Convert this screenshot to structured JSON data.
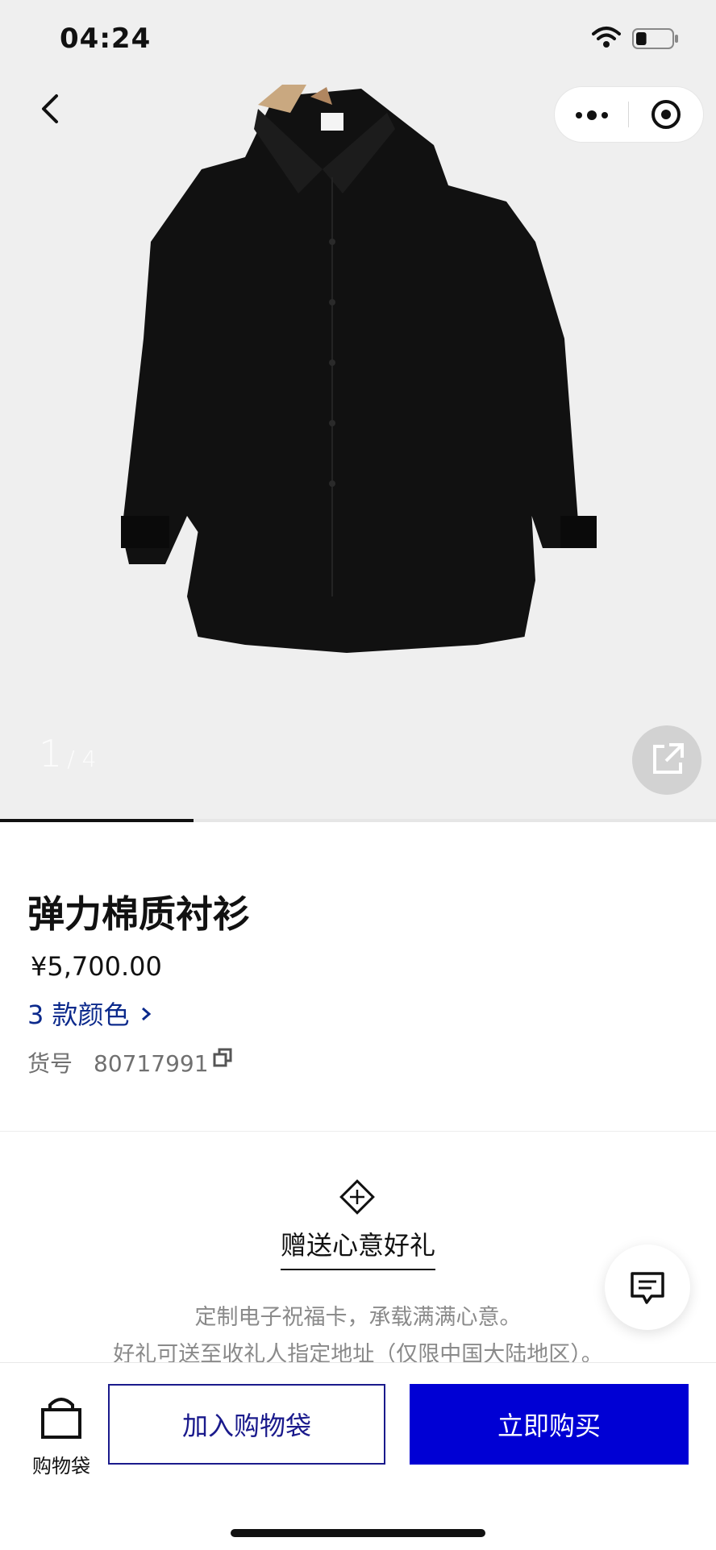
{
  "status_bar": {
    "time": "04:24",
    "battery_level": 0.3
  },
  "gallery": {
    "current": "1",
    "total": "/ 4",
    "progress": 0.27
  },
  "product": {
    "title": "弹力棉质衬衫",
    "price": "¥5,700.00",
    "colors_link": "3 款颜色",
    "sku_label": "货号",
    "sku_value": "80717991"
  },
  "gift": {
    "title": "赠送心意好礼",
    "line1": "定制电子祝福卡，承载满满心意。",
    "line2": "好礼可送至收礼人指定地址（仅限中国大陆地区）。"
  },
  "bottom_bar": {
    "bag_label": "购物袋",
    "add_to_bag": "加入购物袋",
    "buy_now": "立即购买"
  },
  "colors": {
    "brand_blue": "#0000d4",
    "link_blue": "#0c2a8c",
    "shirt": "#111111"
  },
  "icons": [
    "back-icon",
    "more-icon",
    "target-icon",
    "share-icon",
    "copy-icon",
    "gift-icon",
    "chat-icon",
    "bag-icon",
    "wifi-icon",
    "battery-icon"
  ]
}
